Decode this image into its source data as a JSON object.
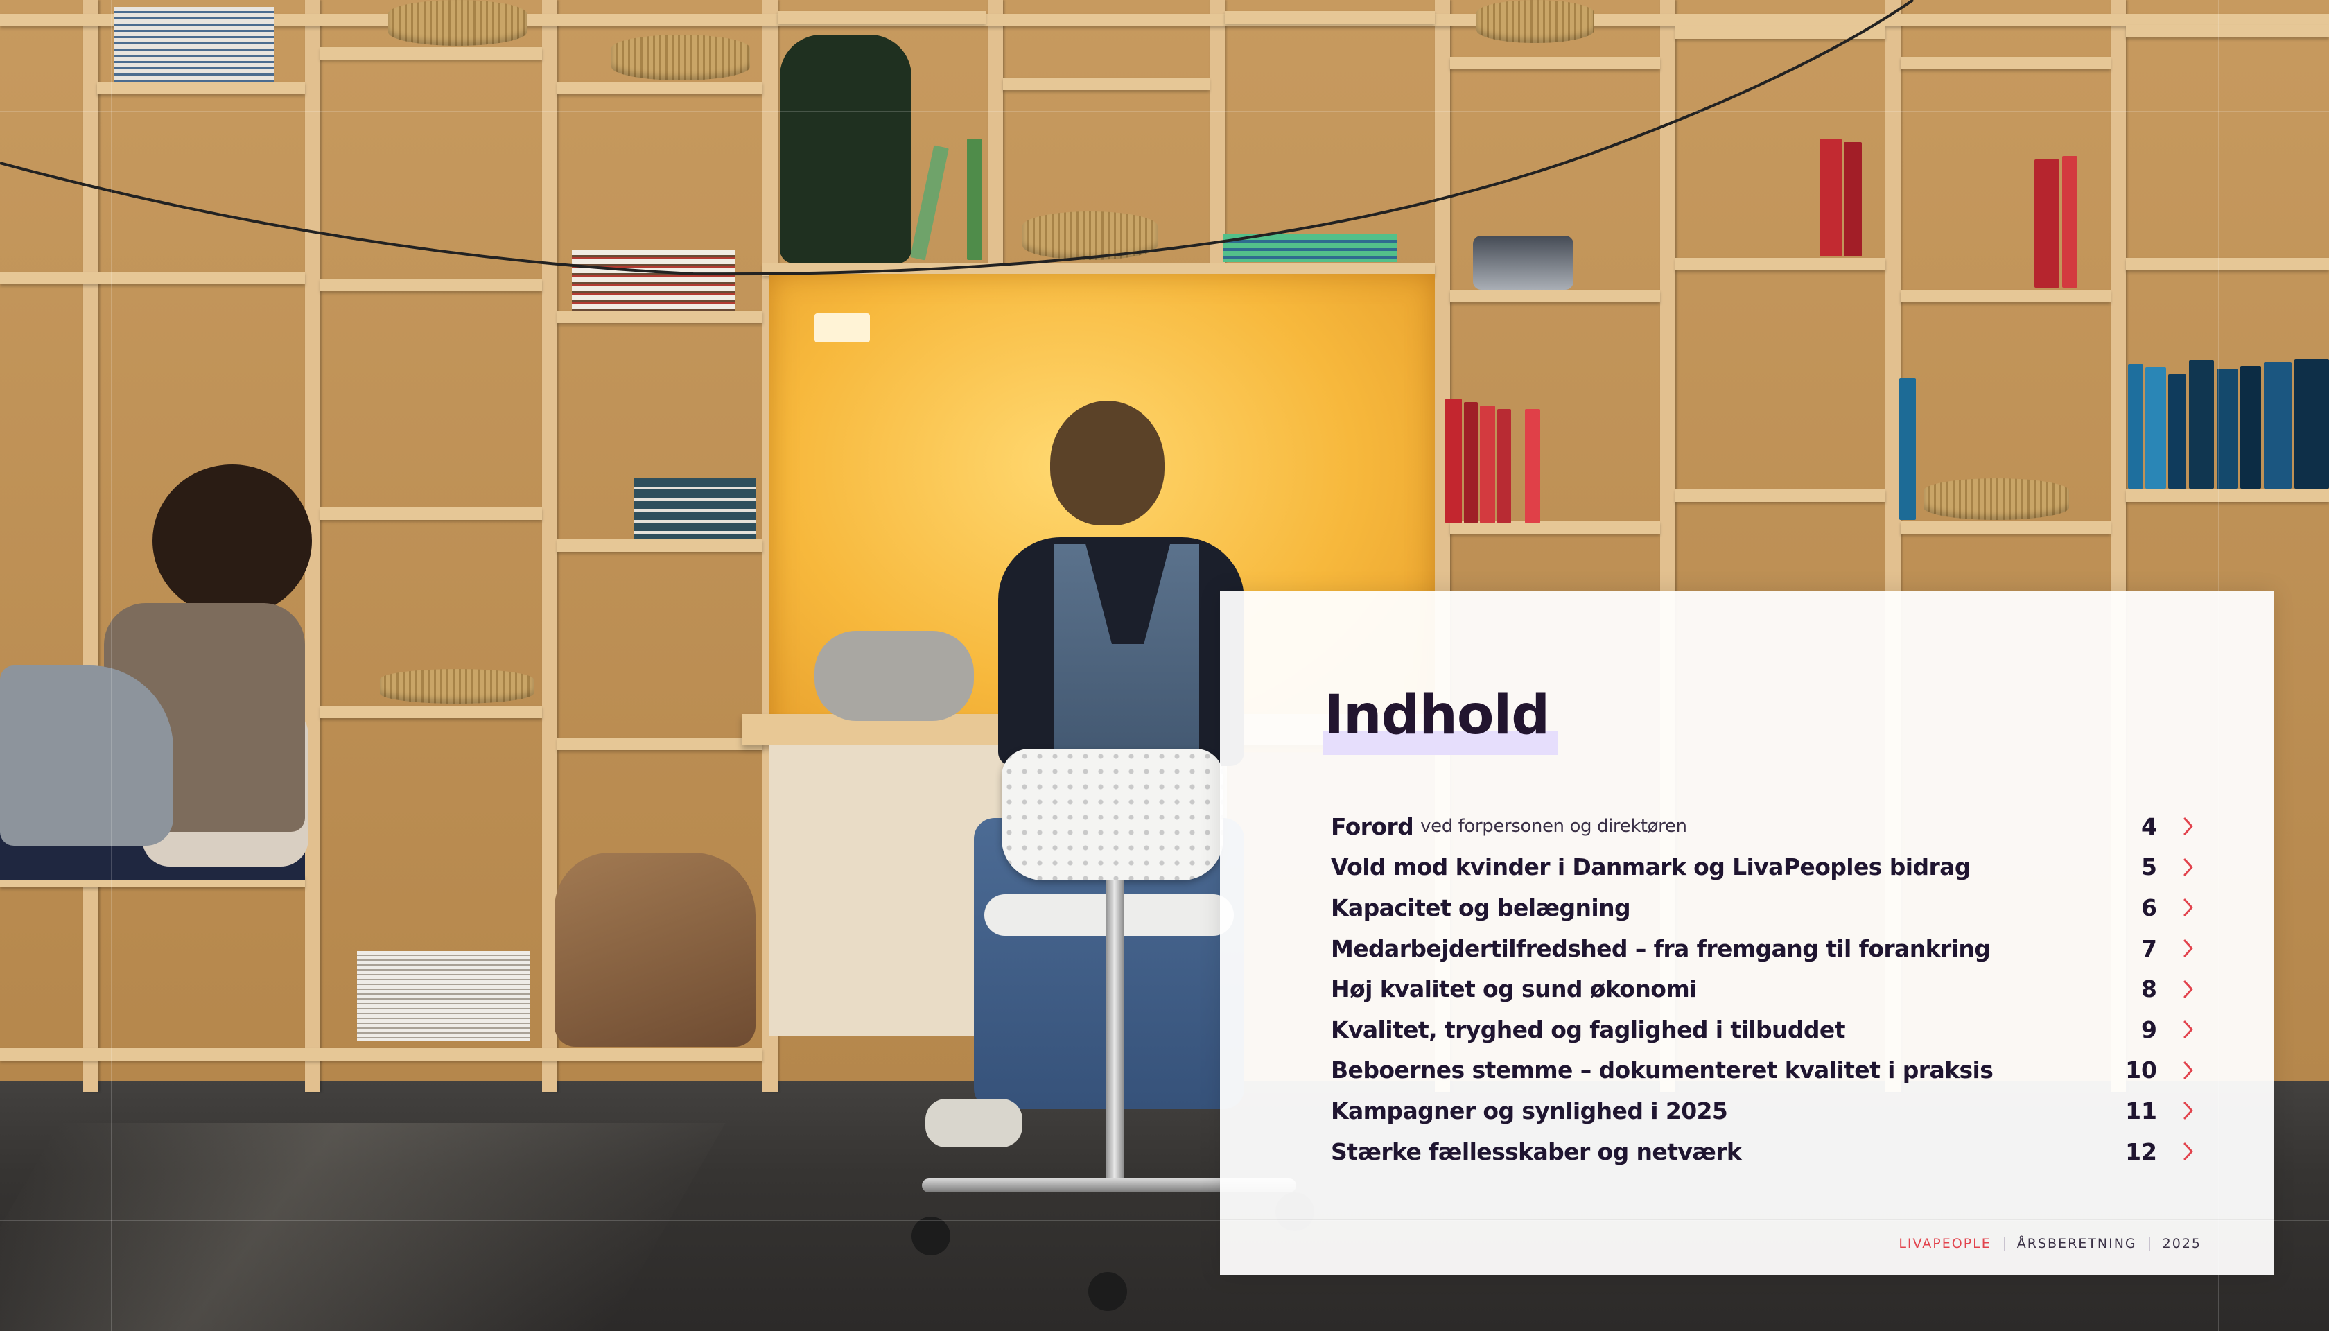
{
  "title": "Indhold",
  "toc": [
    {
      "title": "Forord",
      "subtitle": "ved forpersonen og direktøren",
      "page": "4"
    },
    {
      "title": "Vold mod kvinder i Danmark og LivaPeoples bidrag",
      "subtitle": "",
      "page": "5"
    },
    {
      "title": "Kapacitet og belægning",
      "subtitle": "",
      "page": "6"
    },
    {
      "title": "Medarbejdertilfredshed – fra fremgang til forankring",
      "subtitle": "",
      "page": "7"
    },
    {
      "title": "Høj kvalitet og sund økonomi",
      "subtitle": "",
      "page": "8"
    },
    {
      "title": "Kvalitet, tryghed og faglighed i tilbuddet",
      "subtitle": "",
      "page": "9"
    },
    {
      "title": "Beboernes stemme – dokumenteret kvalitet i praksis",
      "subtitle": "",
      "page": "10"
    },
    {
      "title": "Kampagner og synlighed i 2025",
      "subtitle": "",
      "page": "11"
    },
    {
      "title": "Stærke fællesskaber og netværk",
      "subtitle": "",
      "page": "12"
    }
  ],
  "footer": {
    "brand": "LIVAPEOPLE",
    "document": "ÅRSBERETNING",
    "year": "2025"
  },
  "colors": {
    "accent": "#e2434d",
    "title": "#22152f",
    "highlight": "#e6defc",
    "niche_light": "#f7b83c"
  },
  "icons": {
    "toc_arrow": "chevron-right-icon"
  }
}
